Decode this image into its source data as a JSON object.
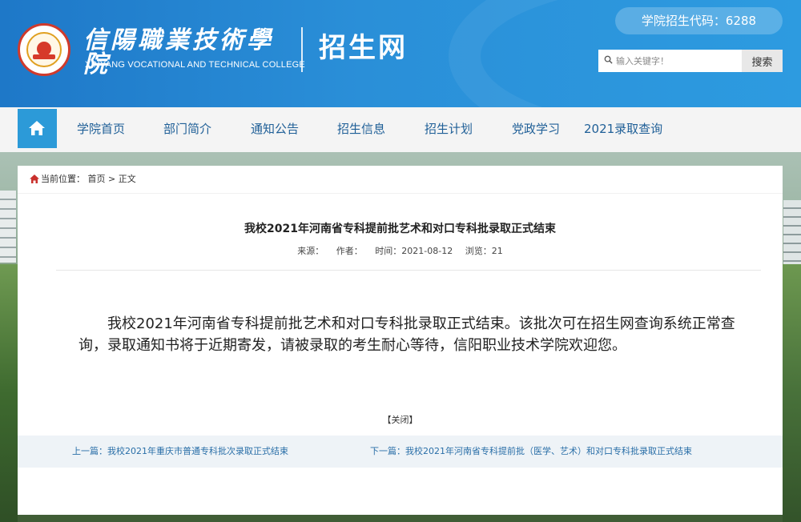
{
  "header": {
    "college_name": "信陽職業技術學院",
    "college_name_en": "XINYANG VOCATIONAL AND TECHNICAL COLLEGE",
    "site_title": "招生网",
    "admission_code": "学院招生代码：6288",
    "search": {
      "placeholder": "输入关键字！",
      "button_label": "搜索"
    }
  },
  "nav": {
    "items": [
      {
        "label": "学院首页"
      },
      {
        "label": "部门简介"
      },
      {
        "label": "通知公告"
      },
      {
        "label": "招生信息"
      },
      {
        "label": "招生计划"
      },
      {
        "label": "党政学习"
      },
      {
        "label": "2021录取查询"
      }
    ]
  },
  "breadcrumb": {
    "prefix": "当前位置：",
    "home": "首页",
    "separator": ">",
    "current": "正文"
  },
  "article": {
    "title": "我校2021年河南省专科提前批艺术和对口专科批录取正式结束",
    "source": "来源：",
    "author": "作者：",
    "time": "时间：2021-08-12",
    "views": "浏览：21",
    "body": "我校2021年河南省专科提前批艺术和对口专科批录取正式结束。该批次可在招生网查询系统正常查询，录取通知书将于近期寄发，请被录取的考生耐心等待，信阳职业技术学院欢迎您。",
    "close_label": "【关闭】",
    "prev": "上一篇：我校2021年重庆市普通专科批次录取正式结束",
    "next": "下一篇：我校2021年河南省专科提前批（医学、艺术）和对口专科批录取正式结束"
  },
  "colors": {
    "header_blue": "#2a8fd8",
    "nav_text": "#1f5f97",
    "home_button": "#2c9ad8",
    "link": "#2a6fa8"
  }
}
